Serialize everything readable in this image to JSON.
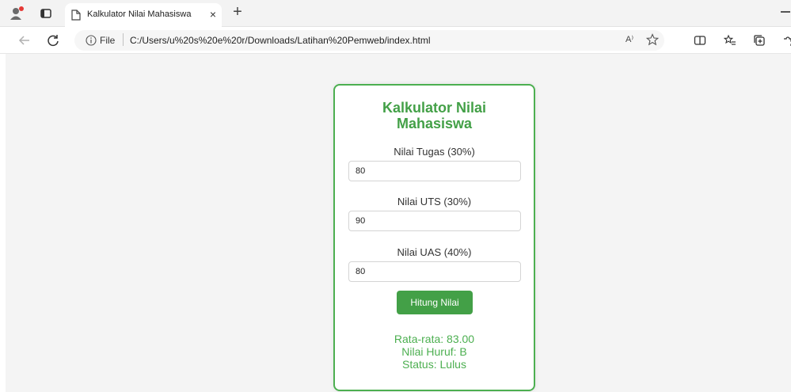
{
  "browser": {
    "tab_title": "Kalkulator Nilai Mahasiswa",
    "close_glyph": "×",
    "new_tab_glyph": "+",
    "file_label": "File",
    "url": "C:/Users/u%20s%20e%20r/Downloads/Latihan%20Pemweb/index.html",
    "read_aloud_glyph": "A⁾"
  },
  "card": {
    "title_line1": "Kalkulator Nilai",
    "title_line2": "Mahasiswa",
    "fields": [
      {
        "label": "Nilai Tugas (30%)",
        "value": "80"
      },
      {
        "label": "Nilai UTS (30%)",
        "value": "90"
      },
      {
        "label": "Nilai UAS (40%)",
        "value": "80"
      }
    ],
    "button_label": "Hitung Nilai",
    "results": {
      "average": "Rata-rata: 83.00",
      "grade": "Nilai Huruf: B",
      "status": "Status: Lulus"
    }
  },
  "colors": {
    "accent": "#4caf50",
    "accent_dark": "#43a047"
  },
  "icons": [
    "profile-icon",
    "sidebar-toggle-icon",
    "document-icon",
    "close-icon",
    "plus-icon",
    "minimize-icon",
    "back-icon",
    "refresh-icon",
    "info-icon",
    "read-aloud-icon",
    "star-icon",
    "split-screen-icon",
    "favorites-icon",
    "collections-icon",
    "extensions-icon"
  ]
}
